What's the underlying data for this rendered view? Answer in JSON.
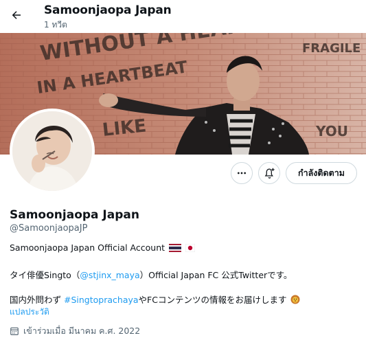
{
  "header": {
    "name": "Samoonjaopa Japan",
    "tweet_count": "1 ทวีต"
  },
  "profile": {
    "name": "Samoonjaopa Japan",
    "handle": "@SamoonjaopaJP",
    "follow_label": "กำลังติดตาม",
    "bio": {
      "line1": "Samoonjaopa Japan Official Account",
      "line2_prefix": "タイ俳優Singto（",
      "line2_mention": "@stjinx_maya",
      "line2_suffix": "）Official Japan FC 公式Twitterです。",
      "line3_prefix": "国内外問わず",
      "line3_hashtag": "#Singtoprachaya",
      "line3_suffix": "やFCコンテンツの情報をお届けします"
    },
    "translate_label": "แปลประวัติ",
    "joined": "เข้าร่วมเมื่อ มีนาคม ค.ศ. 2022"
  },
  "banner_wall_text": [
    "WITHOUT A HEART",
    "IN A HEARTBEAT",
    "LIKE",
    "FRAGILE",
    "YOU"
  ],
  "icons": [
    "back-arrow-icon",
    "more-icon",
    "bell-plus-icon",
    "calendar-icon",
    "thai-flag-icon",
    "japan-flag-icon",
    "lion-emoji-icon"
  ],
  "colors": {
    "link": "#1d9bf0",
    "muted": "#536471",
    "border": "#cfd9de"
  }
}
